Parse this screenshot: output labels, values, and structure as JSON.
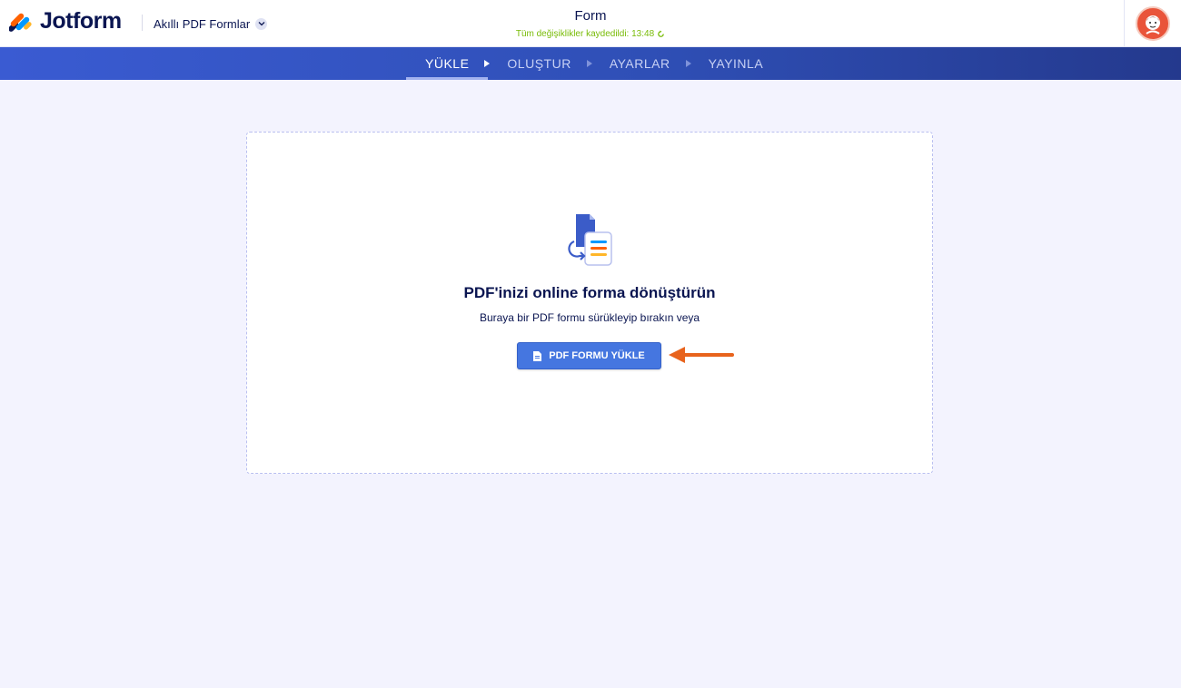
{
  "app": {
    "brand": "Jotform",
    "product": "Akıllı PDF Formlar"
  },
  "header": {
    "form_title": "Form",
    "save_status": "Tüm değişiklikler kaydedildi: 13:48"
  },
  "steps": [
    {
      "label": "YÜKLE",
      "active": true
    },
    {
      "label": "OLUŞTUR",
      "active": false
    },
    {
      "label": "AYARLAR",
      "active": false
    },
    {
      "label": "YAYINLA",
      "active": false
    }
  ],
  "dropzone": {
    "title": "PDF'inizi online forma dönüştürün",
    "subtitle": "Buraya bir PDF formu sürükleyip bırakın veya",
    "button_label": "PDF FORMU YÜKLE"
  },
  "colors": {
    "accent": "#4576e0",
    "nav": "#2f4fb6",
    "save_green": "#78bb07",
    "arrow_orange": "#e8631c"
  },
  "icons": [
    "jotform-logo-icon",
    "chevron-down-icon",
    "refresh-icon",
    "avatar-icon",
    "pdf-convert-icon",
    "file-icon",
    "arrow-left-icon"
  ]
}
